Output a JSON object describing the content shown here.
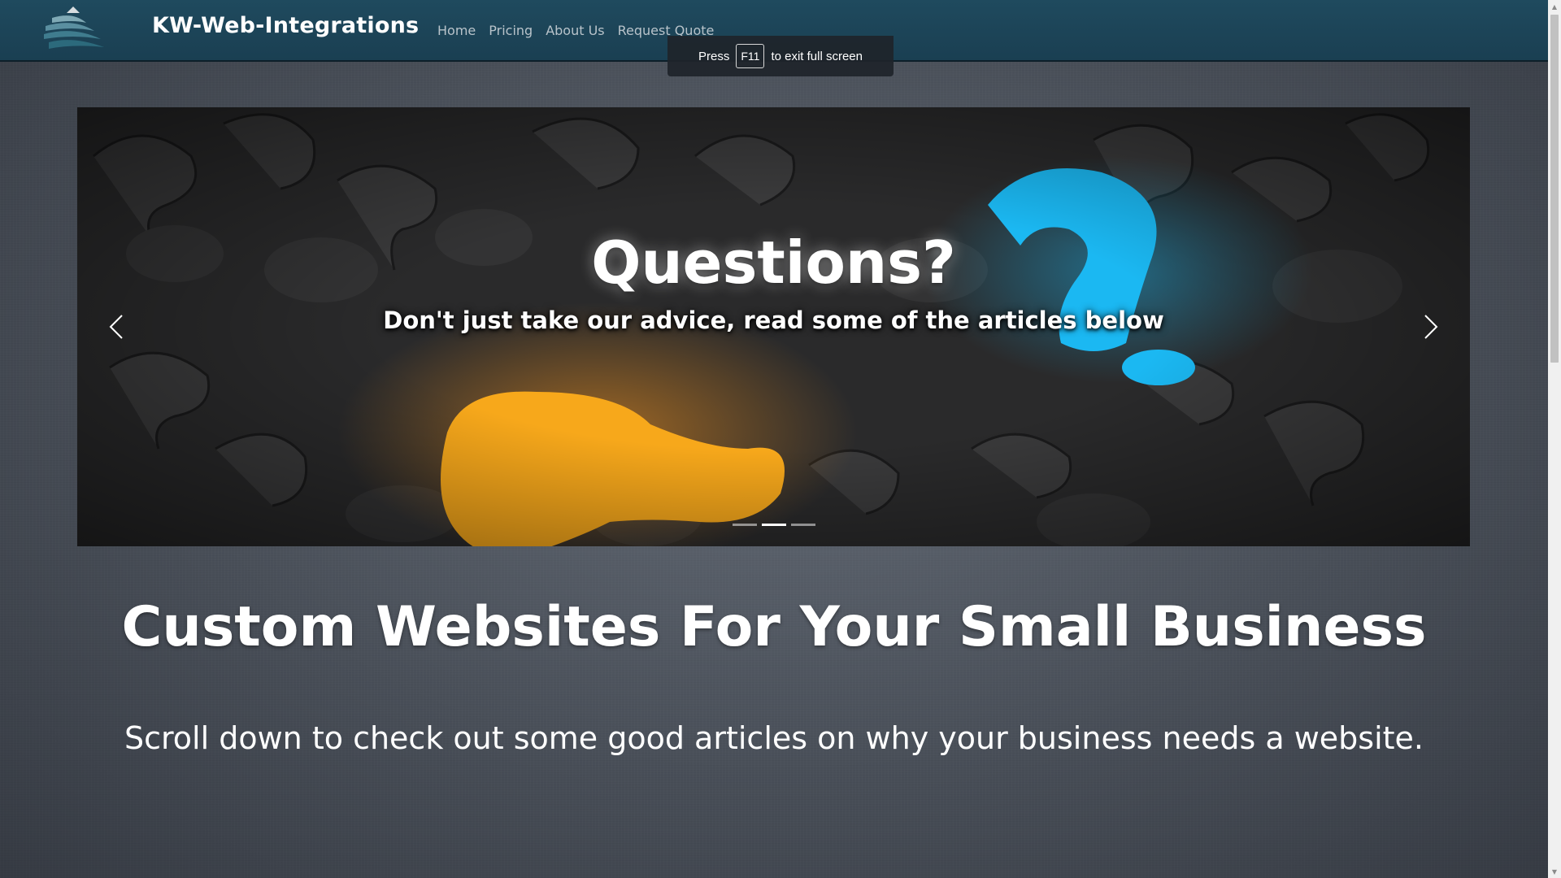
{
  "navbar": {
    "brand": "KW-Web-Integrations",
    "links": [
      {
        "label": "Home"
      },
      {
        "label": "Pricing"
      },
      {
        "label": "About Us"
      },
      {
        "label": "Request Quote"
      }
    ]
  },
  "fullscreen_notice": {
    "prefix": "Press",
    "key": "F11",
    "suffix": "to exit full screen"
  },
  "carousel": {
    "title": "Questions?",
    "subtitle": "Don't just take our advice, read some of the articles below",
    "indicators": 3,
    "active_index": 1,
    "colors": {
      "yellow_mark": "#f7a81b",
      "blue_mark": "#1bb8f2"
    }
  },
  "main": {
    "heading": "Custom Websites For Your Small Business",
    "subheading": "Scroll down to check out some good articles on why your business needs a website."
  },
  "icons": {
    "logo": "stacked-layers-logo",
    "prev": "chevron-left-icon",
    "next": "chevron-right-icon"
  },
  "colors": {
    "navbar": "#1f4a5e",
    "page_background": "#4a5059",
    "nav_link": "#b8c3ca"
  }
}
